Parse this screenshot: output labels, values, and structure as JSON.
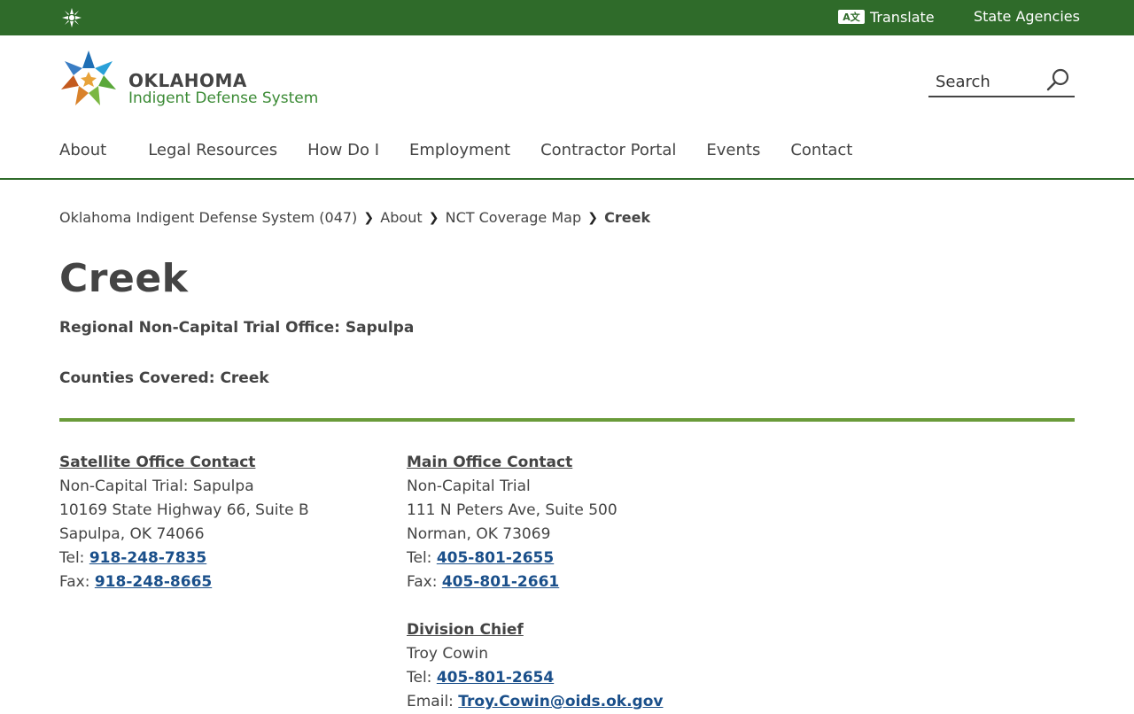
{
  "topbar": {
    "translate_label": "Translate",
    "translate_icon_text": "A文",
    "state_agencies_label": "State Agencies"
  },
  "logo": {
    "line1": "OKLAHOMA",
    "line2": "Indigent Defense System"
  },
  "search": {
    "placeholder": "Search"
  },
  "nav": {
    "items": [
      "About",
      "Legal Resources",
      "How Do I",
      "Employment",
      "Contractor Portal",
      "Events",
      "Contact"
    ]
  },
  "breadcrumb": {
    "items": [
      "Oklahoma Indigent Defense System (047)",
      "About",
      "NCT Coverage Map"
    ],
    "current": "Creek"
  },
  "page": {
    "title": "Creek",
    "regional_office": "Regional Non-Capital Trial Office: Sapulpa",
    "counties": "Counties Covered: Creek"
  },
  "satellite": {
    "heading": "Satellite Office Contact",
    "line1": "Non-Capital Trial: Sapulpa",
    "line2": "10169 State Highway 66, Suite B",
    "line3": "Sapulpa, OK 74066",
    "tel_label": "Tel: ",
    "tel": "918-248-7835",
    "fax_label": "Fax: ",
    "fax": "918-248-8665"
  },
  "main_office": {
    "heading": "Main Office Contact",
    "line1": "Non-Capital Trial",
    "line2": "111 N Peters Ave, Suite 500",
    "line3": "Norman, OK 73069",
    "tel_label": "Tel: ",
    "tel": "405-801-2655",
    "fax_label": "Fax: ",
    "fax": "405-801-2661"
  },
  "division_chief": {
    "heading": "Division Chief",
    "name": "Troy Cowin",
    "tel_label": "Tel: ",
    "tel": "405-801-2654",
    "email_label": "Email: ",
    "email": "Troy.Cowin@oids.ok.gov"
  },
  "colors": {
    "topbar": "#2f6b2a",
    "rule": "#6a9b3a",
    "link": "#1a4f8a"
  }
}
